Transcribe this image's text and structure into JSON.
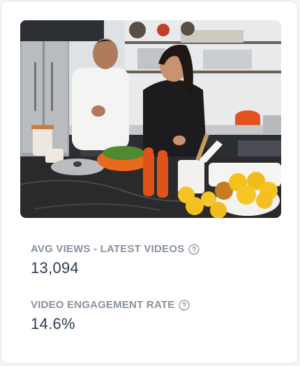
{
  "photo": {
    "subject": "two people cooking in a kitchen"
  },
  "metrics": [
    {
      "label": "AVG VIEWS - LATEST VIDEOS",
      "value": "13,094",
      "icon": "help-icon"
    },
    {
      "label": "VIDEO ENGAGEMENT RATE",
      "value": "14.6%",
      "icon": "help-icon"
    }
  ],
  "colors": {
    "label": "#8893a0",
    "value": "#2d3e50",
    "border": "#dfe3e8"
  }
}
